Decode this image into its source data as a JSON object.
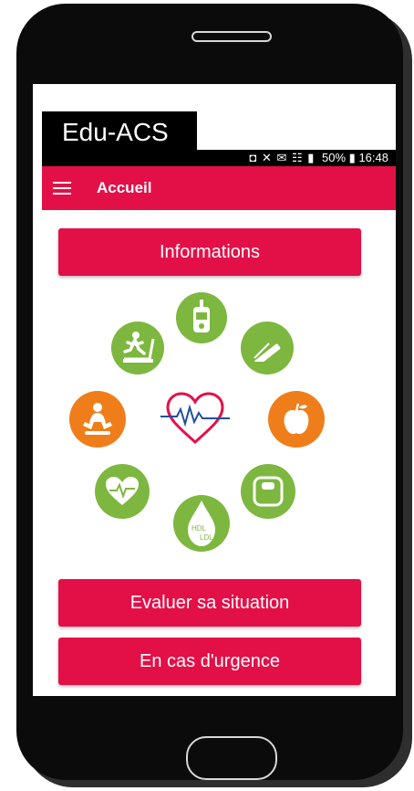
{
  "app": {
    "brand": "Edu-ACS"
  },
  "status_bar": {
    "icons": "◘ ✕ ✉ ☷ ▮",
    "battery": "50%",
    "time": "16:48"
  },
  "header": {
    "title": "Accueil",
    "menu_icon": "hamburger-icon"
  },
  "main": {
    "info_button": "Informations",
    "evaluate_button": "Evaluer sa situation",
    "emergency_button": "En cas d'urgence"
  },
  "illustration": {
    "glucose_labels": {
      "hdl": "HDL",
      "ldl": "LDL"
    },
    "colors": {
      "green": "#7db73f",
      "orange": "#ef7e1a",
      "red": "#e31048"
    }
  }
}
